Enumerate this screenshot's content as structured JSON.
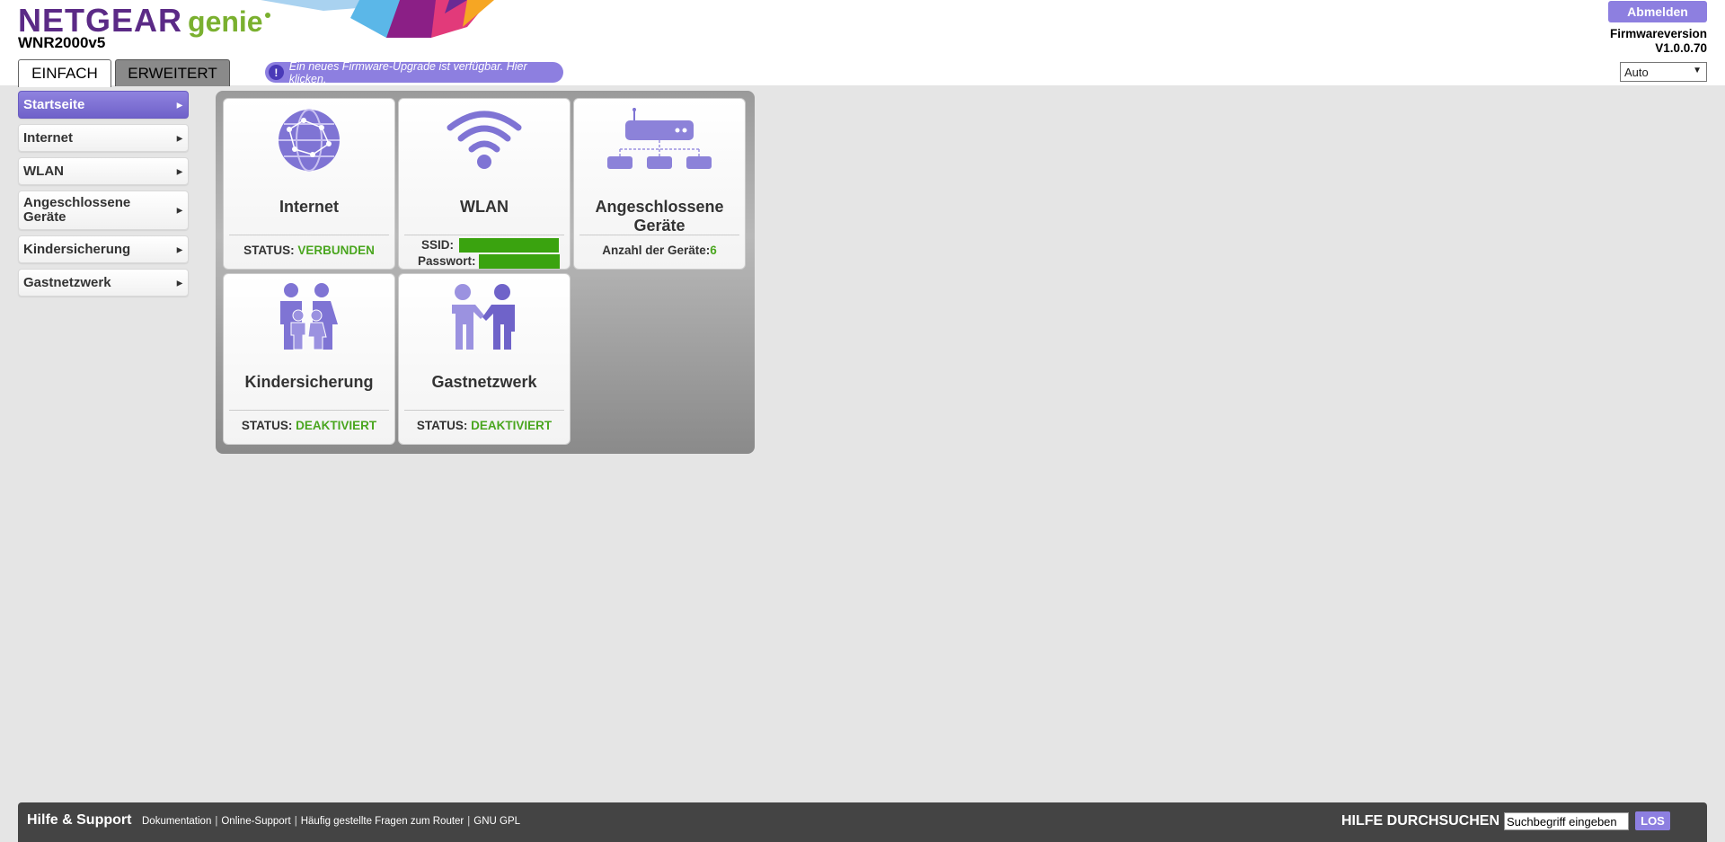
{
  "header": {
    "brand": "NETGEAR",
    "brand_sub": "genie",
    "model": "WNR2000v5",
    "logout_label": "Abmelden",
    "firmware_label": "Firmwareversion",
    "firmware_version": "V1.0.0.70",
    "language_selected": "Auto",
    "firmware_notice": "Ein neues Firmware-Upgrade ist verfügbar. Hier klicken.",
    "notice_icon": "!"
  },
  "tabs": [
    {
      "label": "EINFACH",
      "active": true
    },
    {
      "label": "ERWEITERT",
      "active": false
    }
  ],
  "sidebar": {
    "items": [
      {
        "label": "Startseite",
        "active": true
      },
      {
        "label": "Internet"
      },
      {
        "label": "WLAN"
      },
      {
        "label_line1": "Angeschlossene",
        "label_line2": "Geräte"
      },
      {
        "label": "Kindersicherung"
      },
      {
        "label": "Gastnetzwerk"
      }
    ]
  },
  "tiles": {
    "internet": {
      "title": "Internet",
      "status_label": "STATUS:",
      "status_value": "VERBUNDEN",
      "icon": "globe-icon"
    },
    "wlan": {
      "title": "WLAN",
      "ssid_label": "SSID:",
      "password_label": "Passwort:",
      "icon": "wifi-icon"
    },
    "devices": {
      "title_line1": "Angeschlossene",
      "title_line2": "Geräte",
      "count_label": "Anzahl der Geräte:",
      "count_value": "6",
      "icon": "network-devices-icon"
    },
    "parental": {
      "title": "Kindersicherung",
      "status_label": "STATUS:",
      "status_value": "DEAKTIVIERT",
      "icon": "family-icon"
    },
    "guest": {
      "title": "Gastnetzwerk",
      "status_label": "STATUS:",
      "status_value": "DEAKTIVIERT",
      "icon": "handshake-icon"
    }
  },
  "footer": {
    "title": "Hilfe & Support",
    "links": [
      "Dokumentation",
      "Online-Support",
      "Häufig gestellte Fragen zum Router",
      "GNU GPL"
    ],
    "search_label": "HILFE DURCHSUCHEN",
    "search_value": "Suchbegriff eingeben",
    "go_label": "LOS"
  },
  "colors": {
    "accent": "#8d7fe0",
    "brand_purple": "#5b2a86",
    "brand_green": "#7ab02f",
    "status_green": "#4aa61f"
  }
}
